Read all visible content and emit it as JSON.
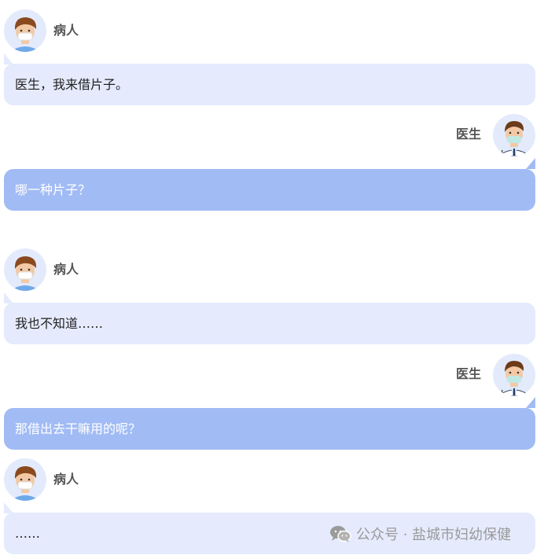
{
  "messages": [
    {
      "speaker": "病人",
      "text": "医生，我来借片子。"
    },
    {
      "speaker": "医生",
      "text": "哪一种片子？"
    },
    {
      "speaker": "病人",
      "text": "我也不知道……"
    },
    {
      "speaker": "医生",
      "text": "那借出去干嘛用的呢？"
    },
    {
      "speaker": "病人",
      "text": "……"
    }
  ],
  "watermark": {
    "icon": "wechat-icon",
    "text": "公众号 · 盐城市妇幼保健"
  },
  "colors": {
    "avatar_bg": "#e3eafc",
    "patient_bubble": "#e5ebfd",
    "doctor_bubble": "#a1bbf5",
    "name_text": "#555555",
    "watermark_text": "#9a9a9a"
  }
}
